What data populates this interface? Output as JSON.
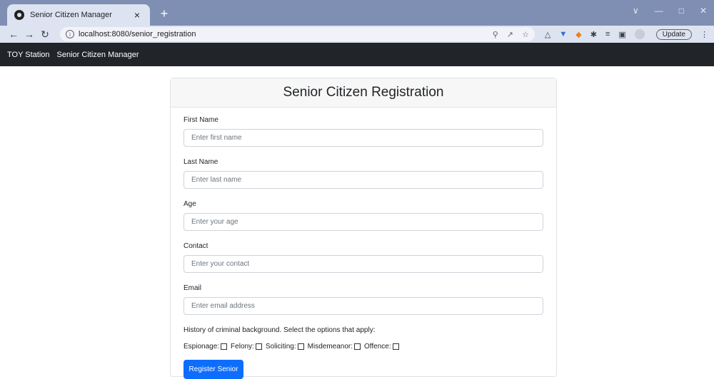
{
  "browser": {
    "tab_title": "Senior Citizen Manager",
    "tab_close": "×",
    "new_tab": "+",
    "url": "localhost:8080/senior_registration",
    "update_label": "Update"
  },
  "app_nav": {
    "brand": "TOY Station",
    "link": "Senior Citizen Manager"
  },
  "form": {
    "title": "Senior Citizen Registration",
    "fields": [
      {
        "label": "First Name",
        "placeholder": "Enter first name"
      },
      {
        "label": "Last Name",
        "placeholder": "Enter last name"
      },
      {
        "label": "Age",
        "placeholder": "Enter your age"
      },
      {
        "label": "Contact",
        "placeholder": "Enter your contact"
      },
      {
        "label": "Email",
        "placeholder": "Enter email address"
      }
    ],
    "criminal_note": "History of criminal background. Select the options that apply:",
    "checkboxes": [
      "Espionage:",
      "Felony:",
      "Soliciting:",
      "Misdemeanor:",
      "Offence:"
    ],
    "submit_label": "Register Senior"
  },
  "colors": {
    "navbar": "#212529",
    "primary": "#0d6efd",
    "tabbar": "#7f8fb3"
  }
}
